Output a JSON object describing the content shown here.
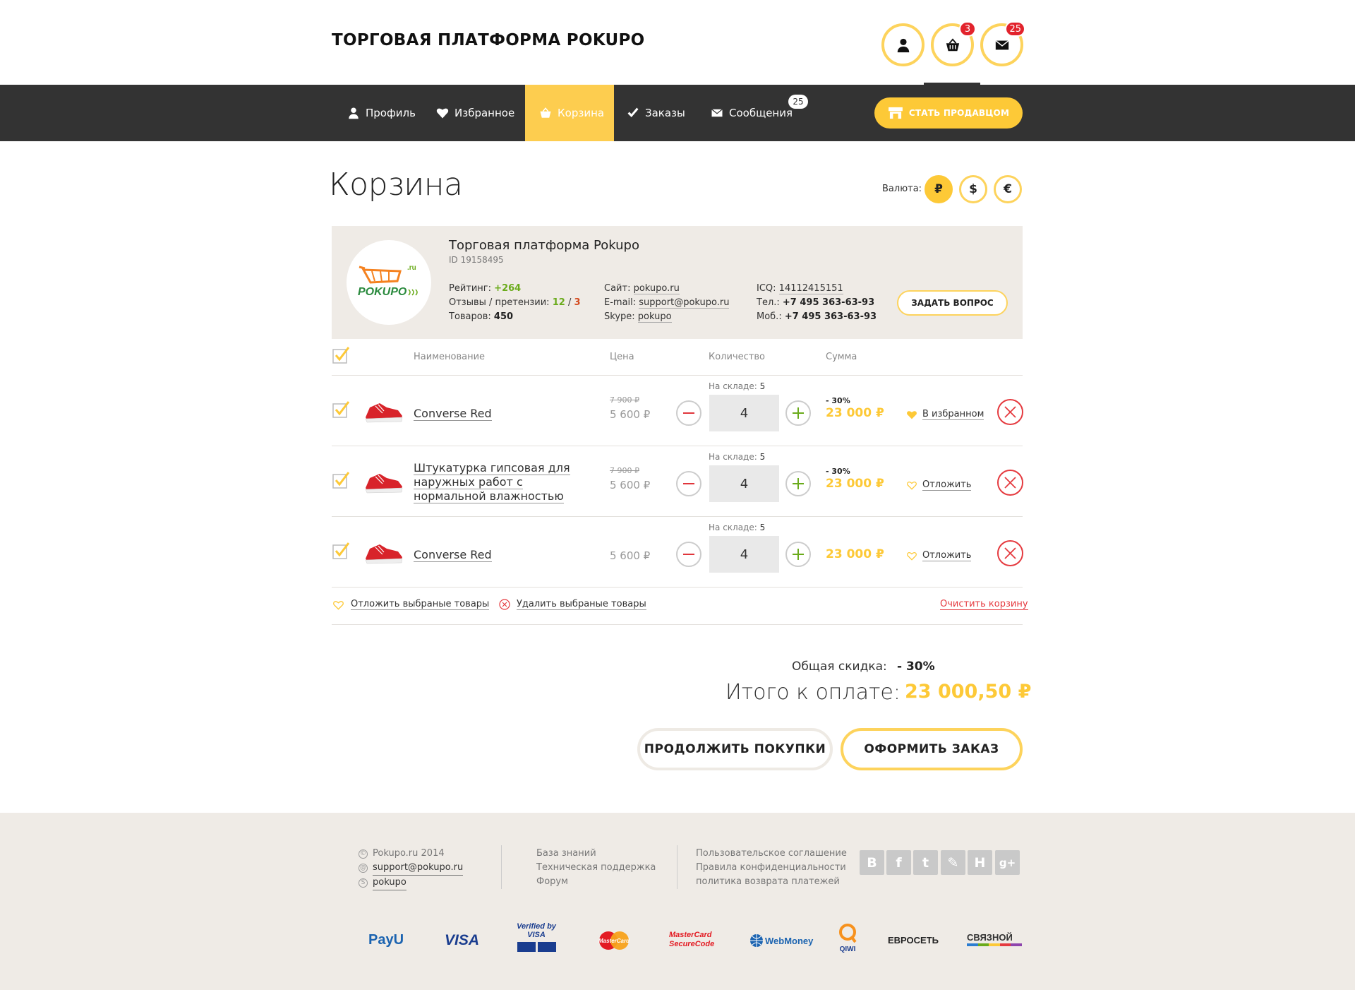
{
  "header": {
    "site_title": "ТОРГОВАЯ ПЛАТФОРМА POKUPO",
    "cart_badge": "3",
    "messages_badge": "25"
  },
  "nav": {
    "items": [
      {
        "label": "Профиль",
        "icon": "user-icon"
      },
      {
        "label": "Избранное",
        "icon": "heart-icon"
      },
      {
        "label": "Корзина",
        "icon": "basket-icon",
        "active": true
      },
      {
        "label": "Заказы",
        "icon": "check-icon"
      },
      {
        "label": "Сообщения",
        "icon": "envelope-icon",
        "badge": "25"
      }
    ],
    "seller_button": "СТАТЬ ПРОДАВЦОМ"
  },
  "page": {
    "title": "Корзина",
    "currency_label": "Валюта:",
    "currencies": [
      "₽",
      "$",
      "€"
    ],
    "active_currency": "₽"
  },
  "seller": {
    "name": "Торговая платформа Pokupo",
    "id": "ID 19158495",
    "logo_text": "POKUPO",
    "logo_ru": ".ru",
    "rating_label": "Рейтинг:",
    "rating_value": "+264",
    "reviews_label": "Отзывы / претензии:",
    "reviews_pos": "12",
    "reviews_sep": "/",
    "reviews_neg": "3",
    "goods_label": "Товаров:",
    "goods_value": "450",
    "site_label": "Сайт:",
    "site_value": "pokupo.ru",
    "email_label": "E-mail:",
    "email_value": "support@pokupo.ru",
    "skype_label": "Skype:",
    "skype_value": "pokupo",
    "icq_label": "ICQ:",
    "icq_value": "14112415151",
    "phone_label": "Тел.:",
    "phone_value": "+7 495 363-63-93",
    "mobile_label": "Моб.:",
    "mobile_value": "+7 495 363-63-93",
    "ask_button": "ЗАДАТЬ ВОПРОС"
  },
  "table": {
    "headers": {
      "name": "Наименование",
      "price": "Цена",
      "qty": "Количество",
      "sum": "Сумма"
    },
    "stock_label": "На складе:",
    "rows": [
      {
        "name": "Converse Red",
        "old_price": "7 900 ₽",
        "price": "5 600 ₽",
        "stock": "5",
        "qty": "4",
        "discount": "- 30%",
        "sum": "23 000 ₽",
        "fav_label": "В избранном",
        "in_fav": true
      },
      {
        "name": "Штукатурка гипсовая для наружных работ с нормальной влажностью",
        "old_price": "7 900 ₽",
        "price": "5 600 ₽",
        "stock": "5",
        "qty": "4",
        "discount": "- 30%",
        "sum": "23 000 ₽",
        "fav_label": "Отложить",
        "in_fav": false
      },
      {
        "name": "Converse Red",
        "old_price": "",
        "price": "5 600 ₽",
        "stock": "5",
        "qty": "4",
        "discount": "",
        "sum": "23 000 ₽",
        "fav_label": "Отложить",
        "in_fav": false
      }
    ],
    "postpone_selected": "Отложить выбраные товары",
    "delete_selected": "Удалить выбраные товары",
    "clear_cart": "Очистить корзину"
  },
  "totals": {
    "discount_label": "Общая скидка:",
    "discount_value": "- 30%",
    "total_label": "Итого к оплате:",
    "total_value": "23 000,50 ₽",
    "continue_button": "ПРОДОЛЖИТЬ ПОКУПКИ",
    "order_button": "ОФОРМИТЬ ЗАКАЗ"
  },
  "footer": {
    "copyright": "Pokupo.ru 2014",
    "email": "support@pokupo.ru",
    "skype": "pokupo",
    "links_col2": [
      "База знаний",
      "Техническая поддержка",
      "Форум"
    ],
    "links_col3": [
      "Пользовательское соглашение",
      "Правила конфиденциальности",
      "политика возврата платежей"
    ],
    "social": [
      "В",
      "f",
      "t",
      "✎",
      "Н",
      "g+"
    ],
    "payments": [
      "PayU",
      "VISA",
      "Verified by VISA",
      "MasterCard",
      "MasterCard SecureCode",
      "WebMoney",
      "QIWI",
      "ЕВРОСЕТЬ",
      "СВЯЗНОЙ"
    ]
  },
  "colors": {
    "accent": "#fdc937",
    "dark": "#333333",
    "danger": "#e53a3f",
    "green": "#6aab1b",
    "beige": "#efebe6"
  }
}
